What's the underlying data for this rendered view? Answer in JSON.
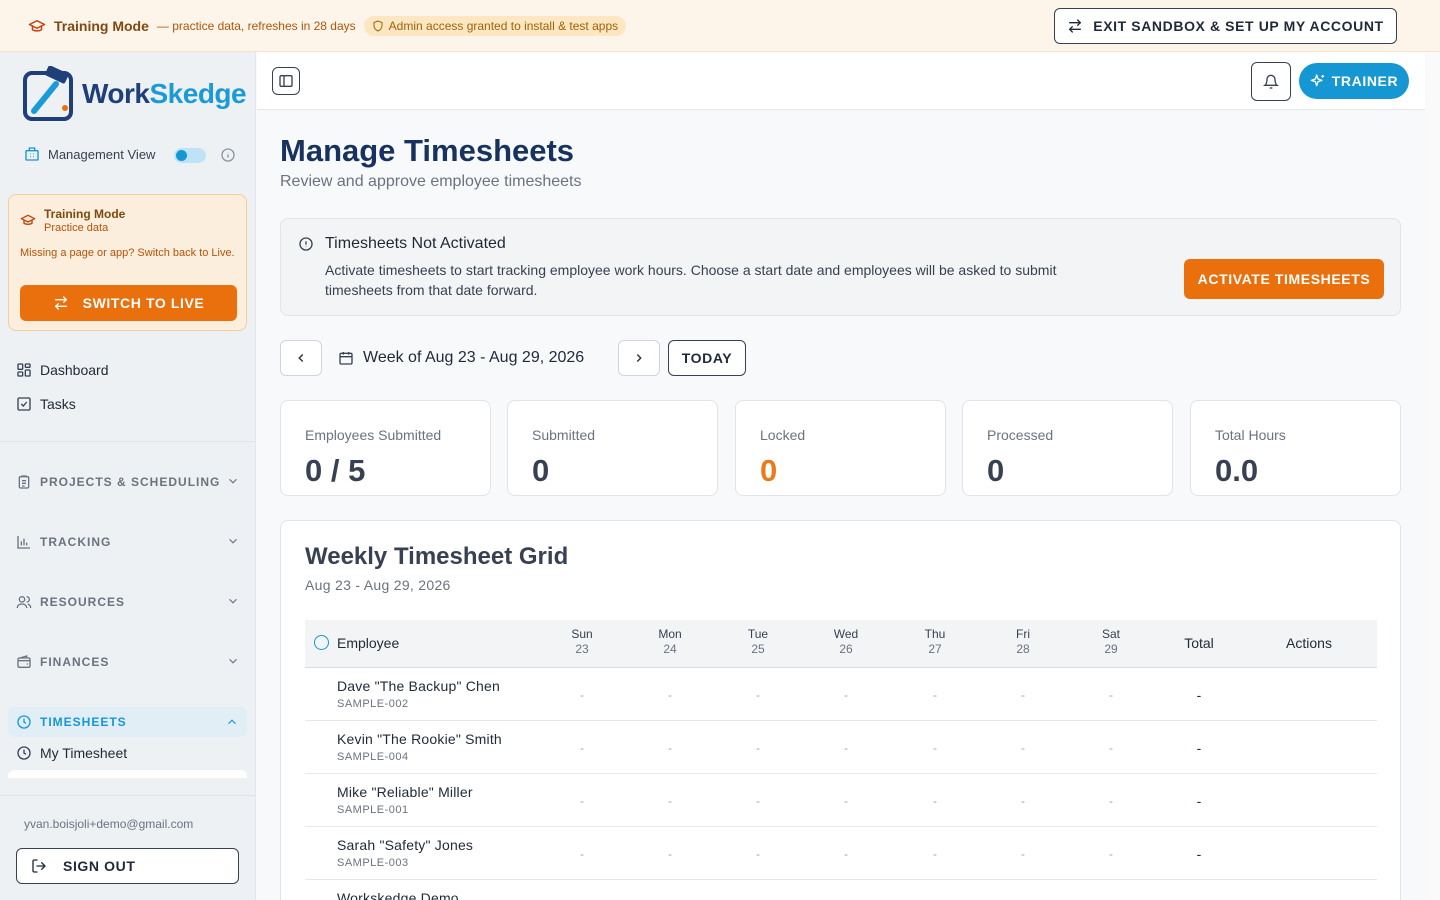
{
  "banner": {
    "title": "Training Mode",
    "subtitle": "— practice data, refreshes in 28 days",
    "admin_pill": "Admin access granted to install & test apps",
    "exit_button": "EXIT SANDBOX & SET UP MY ACCOUNT"
  },
  "sidebar": {
    "logo": {
      "part1": "Work",
      "part2": "Skedge"
    },
    "management_view": {
      "label": "Management View",
      "enabled": true
    },
    "training_card": {
      "title": "Training Mode",
      "subtitle": "Practice data",
      "description": "Missing a page or app? Switch back to Live.",
      "button": "SWITCH TO LIVE"
    },
    "items": [
      {
        "label": "Dashboard",
        "icon": "grid-icon"
      },
      {
        "label": "Tasks",
        "icon": "checkbox-icon"
      }
    ],
    "sections": [
      {
        "label": "PROJECTS & SCHEDULING",
        "icon": "clipboard-icon",
        "expanded": false
      },
      {
        "label": "TRACKING",
        "icon": "bar-chart-icon",
        "expanded": false
      },
      {
        "label": "RESOURCES",
        "icon": "users-icon",
        "expanded": false
      },
      {
        "label": "FINANCES",
        "icon": "wallet-icon",
        "expanded": false
      },
      {
        "label": "TIMESHEETS",
        "icon": "clock-icon",
        "expanded": true
      }
    ],
    "timesheet_items": [
      {
        "label": "My Timesheet",
        "icon": "clock-icon"
      }
    ],
    "email": "yvan.boisjoli+demo@gmail.com",
    "sign_out": "SIGN OUT"
  },
  "topbar": {
    "trainer_button": "TRAINER"
  },
  "page": {
    "title": "Manage Timesheets",
    "subtitle": "Review and approve employee timesheets"
  },
  "alert": {
    "title": "Timesheets Not Activated",
    "description": "Activate timesheets to start tracking employee work hours. Choose a start date and employees will be asked to submit timesheets from that date forward.",
    "button": "ACTIVATE TIMESHEETS"
  },
  "week_nav": {
    "label": "Week of Aug 23 - Aug 29, 2026",
    "today": "TODAY"
  },
  "stats": [
    {
      "label": "Employees Submitted",
      "value": "0 / 5"
    },
    {
      "label": "Submitted",
      "value": "0"
    },
    {
      "label": "Locked",
      "value": "0",
      "color": "#ea7a1a"
    },
    {
      "label": "Processed",
      "value": "0"
    },
    {
      "label": "Total Hours",
      "value": "0.0"
    }
  ],
  "grid": {
    "title": "Weekly Timesheet Grid",
    "subtitle": "Aug 23 - Aug 29, 2026",
    "columns": {
      "employee": "Employee",
      "days": [
        {
          "name": "Sun",
          "date": "23"
        },
        {
          "name": "Mon",
          "date": "24"
        },
        {
          "name": "Tue",
          "date": "25"
        },
        {
          "name": "Wed",
          "date": "26"
        },
        {
          "name": "Thu",
          "date": "27"
        },
        {
          "name": "Fri",
          "date": "28"
        },
        {
          "name": "Sat",
          "date": "29"
        }
      ],
      "total": "Total",
      "actions": "Actions"
    },
    "rows": [
      {
        "name": "Dave \"The Backup\" Chen",
        "id": "SAMPLE-002",
        "days": [
          "-",
          "-",
          "-",
          "-",
          "-",
          "-",
          "-"
        ],
        "total": "-"
      },
      {
        "name": "Kevin \"The Rookie\" Smith",
        "id": "SAMPLE-004",
        "days": [
          "-",
          "-",
          "-",
          "-",
          "-",
          "-",
          "-"
        ],
        "total": "-"
      },
      {
        "name": "Mike \"Reliable\" Miller",
        "id": "SAMPLE-001",
        "days": [
          "-",
          "-",
          "-",
          "-",
          "-",
          "-",
          "-"
        ],
        "total": "-"
      },
      {
        "name": "Sarah \"Safety\" Jones",
        "id": "SAMPLE-003",
        "days": [
          "-",
          "-",
          "-",
          "-",
          "-",
          "-",
          "-"
        ],
        "total": "-"
      },
      {
        "name": "Workskedge Demo",
        "id": "",
        "days": [
          "",
          "",
          "",
          "",
          "",
          "",
          ""
        ],
        "total": ""
      }
    ]
  },
  "colors": {
    "brand_blue": "#1597d4",
    "brand_navy": "#1f3f79",
    "accent_orange": "#ea6f0d",
    "title_navy": "#17325e"
  }
}
